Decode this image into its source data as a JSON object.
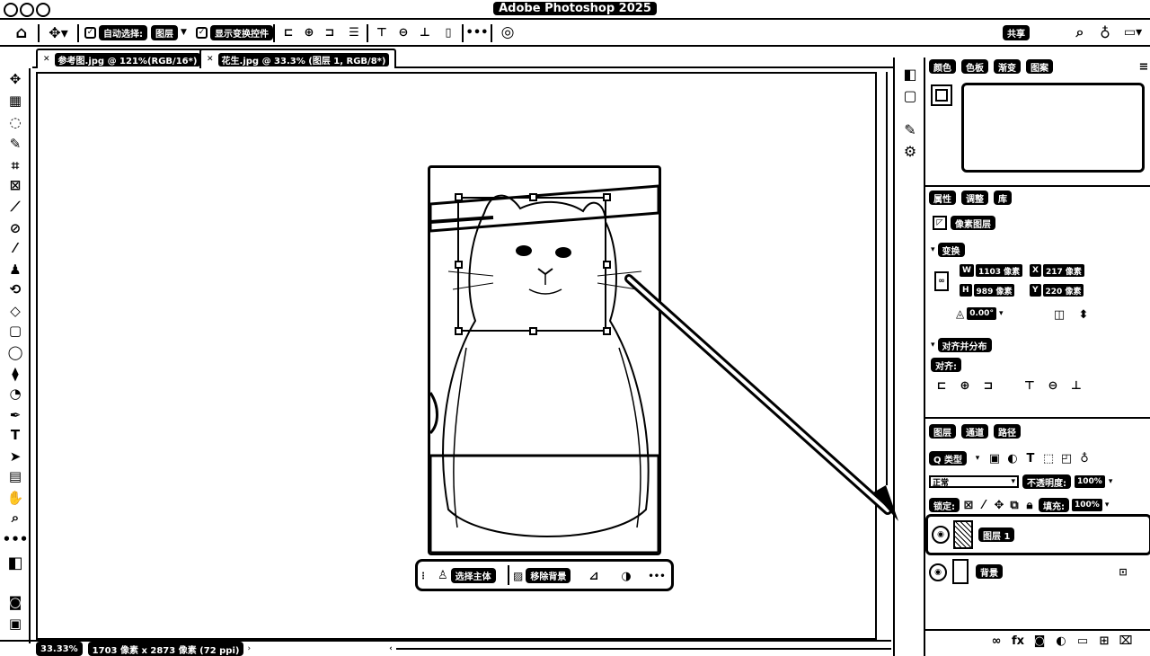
{
  "window": {
    "title": "Adobe Photoshop 2025"
  },
  "options_bar": {
    "auto_select_label": "自动选择:",
    "layer_select_value": "图层",
    "show_transform_label": "显示变换控件",
    "share_label": "共享"
  },
  "tabs": [
    {
      "label": "参考图.jpg @ 121%(RGB/16*)"
    },
    {
      "label": "花生.jpg @ 33.3% (图层 1, RGB/8*)"
    }
  ],
  "context_bar": {
    "select_subject": "选择主体",
    "remove_background": "移除背景"
  },
  "panels": {
    "top_tabs": [
      "颜色",
      "色板",
      "渐变",
      "图案"
    ],
    "props_tabs": [
      "属性",
      "调整",
      "库"
    ],
    "pixel_layer": "像素图层",
    "transform_label": "变换",
    "w_value": "1103 像素",
    "x_value": "217 像素",
    "h_value": "989 像素",
    "y_value": "220 像素",
    "angle_value": "0.00°",
    "align_section": "对齐并分布",
    "align_label": "对齐:",
    "layers_tabs": [
      "图层",
      "通道",
      "路径"
    ],
    "filter_kind": "Q 类型",
    "blend_mode": "正常",
    "opacity_label": "不透明度:",
    "opacity_value": "100%",
    "lock_label": "锁定:",
    "fill_label": "填充:",
    "fill_value": "100%",
    "layers": [
      {
        "name": "图层 1"
      },
      {
        "name": "背景"
      }
    ]
  },
  "status": {
    "zoom": "33.33%",
    "doc_info": "1703 像素 x 2873 像素 (72 ppi)"
  },
  "icons": [
    "home-icon",
    "move-icon",
    "zoom-icon",
    "search-icon",
    "lightbulb-icon",
    "eye-icon",
    "lock-icon",
    "trash-icon"
  ]
}
